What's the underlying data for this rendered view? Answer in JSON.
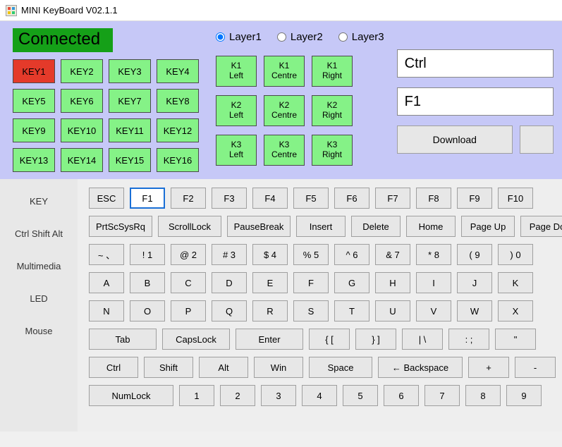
{
  "window": {
    "title": "MINI KeyBoard V02.1.1"
  },
  "status": {
    "text": "Connected"
  },
  "keys": {
    "list": [
      "KEY1",
      "KEY2",
      "KEY3",
      "KEY4",
      "KEY5",
      "KEY6",
      "KEY7",
      "KEY8",
      "KEY9",
      "KEY10",
      "KEY11",
      "KEY12",
      "KEY13",
      "KEY14",
      "KEY15",
      "KEY16"
    ],
    "selected_index": 0,
    "k0": "KEY1",
    "k1": "KEY2",
    "k2": "KEY3",
    "k3": "KEY4",
    "k4": "KEY5",
    "k5": "KEY6",
    "k6": "KEY7",
    "k7": "KEY8",
    "k8": "KEY9",
    "k9": "KEY10",
    "k10": "KEY11",
    "k11": "KEY12",
    "k12": "KEY13",
    "k13": "KEY14",
    "k14": "KEY15",
    "k15": "KEY16"
  },
  "layers": {
    "options": [
      "Layer1",
      "Layer2",
      "Layer3"
    ],
    "selected_index": 0,
    "o0": "Layer1",
    "o1": "Layer2",
    "o2": "Layer3"
  },
  "knobs": {
    "k1l_a": "K1",
    "k1l_b": "Left",
    "k1c_a": "K1",
    "k1c_b": "Centre",
    "k1r_a": "K1",
    "k1r_b": "Right",
    "k2l_a": "K2",
    "k2l_b": "Left",
    "k2c_a": "K2",
    "k2c_b": "Centre",
    "k2r_a": "K2",
    "k2r_b": "Right",
    "k3l_a": "K3",
    "k3l_b": "Left",
    "k3c_a": "K3",
    "k3c_b": "Centre",
    "k3r_a": "K3",
    "k3r_b": "Right"
  },
  "fields": {
    "modifier": "Ctrl",
    "key": "F1"
  },
  "buttons": {
    "download": "Download"
  },
  "tabs": {
    "items": [
      "KEY",
      "Ctrl Shift Alt",
      "Multimedia",
      "LED",
      "Mouse"
    ],
    "t0": "KEY",
    "t1": "Ctrl Shift Alt",
    "t2": "Multimedia",
    "t3": "LED",
    "t4": "Mouse",
    "active_index": 0
  },
  "vkb": {
    "r0": {
      "c0": "ESC",
      "c1": "F1",
      "c2": "F2",
      "c3": "F3",
      "c4": "F4",
      "c5": "F5",
      "c6": "F6",
      "c7": "F7",
      "c8": "F8",
      "c9": "F9",
      "c10": "F10"
    },
    "r1": {
      "c0": "PrtScSysRq",
      "c1": "ScrollLock",
      "c2": "PauseBreak",
      "c3": "Insert",
      "c4": "Delete",
      "c5": "Home",
      "c6": "Page Up",
      "c7": "Page Do"
    },
    "r2": {
      "c0": "~ 、",
      "c1": "! 1",
      "c2": "@ 2",
      "c3": "# 3",
      "c4": "$ 4",
      "c5": "% 5",
      "c6": "^ 6",
      "c7": "& 7",
      "c8": "* 8",
      "c9": "( 9",
      "c10": ") 0"
    },
    "r3": {
      "c0": "A",
      "c1": "B",
      "c2": "C",
      "c3": "D",
      "c4": "E",
      "c5": "F",
      "c6": "G",
      "c7": "H",
      "c8": "I",
      "c9": "J",
      "c10": "K"
    },
    "r4": {
      "c0": "N",
      "c1": "O",
      "c2": "P",
      "c3": "Q",
      "c4": "R",
      "c5": "S",
      "c6": "T",
      "c7": "U",
      "c8": "V",
      "c9": "W",
      "c10": "X"
    },
    "r5": {
      "c0": "Tab",
      "c1": "CapsLock",
      "c2": "Enter",
      "c3": "{ [",
      "c4": "} ]",
      "c5": "| \\",
      "c6": ": ;",
      "c7": "\""
    },
    "r6": {
      "c0": "Ctrl",
      "c1": "Shift",
      "c2": "Alt",
      "c3": "Win",
      "c4": "Space",
      "c5": "← Backspace",
      "c6": "+",
      "c7": "-"
    },
    "r7": {
      "c0": "NumLock",
      "c1": "1",
      "c2": "2",
      "c3": "3",
      "c4": "4",
      "c5": "5",
      "c6": "6",
      "c7": "7",
      "c8": "8",
      "c9": "9"
    },
    "selected": "F1"
  }
}
